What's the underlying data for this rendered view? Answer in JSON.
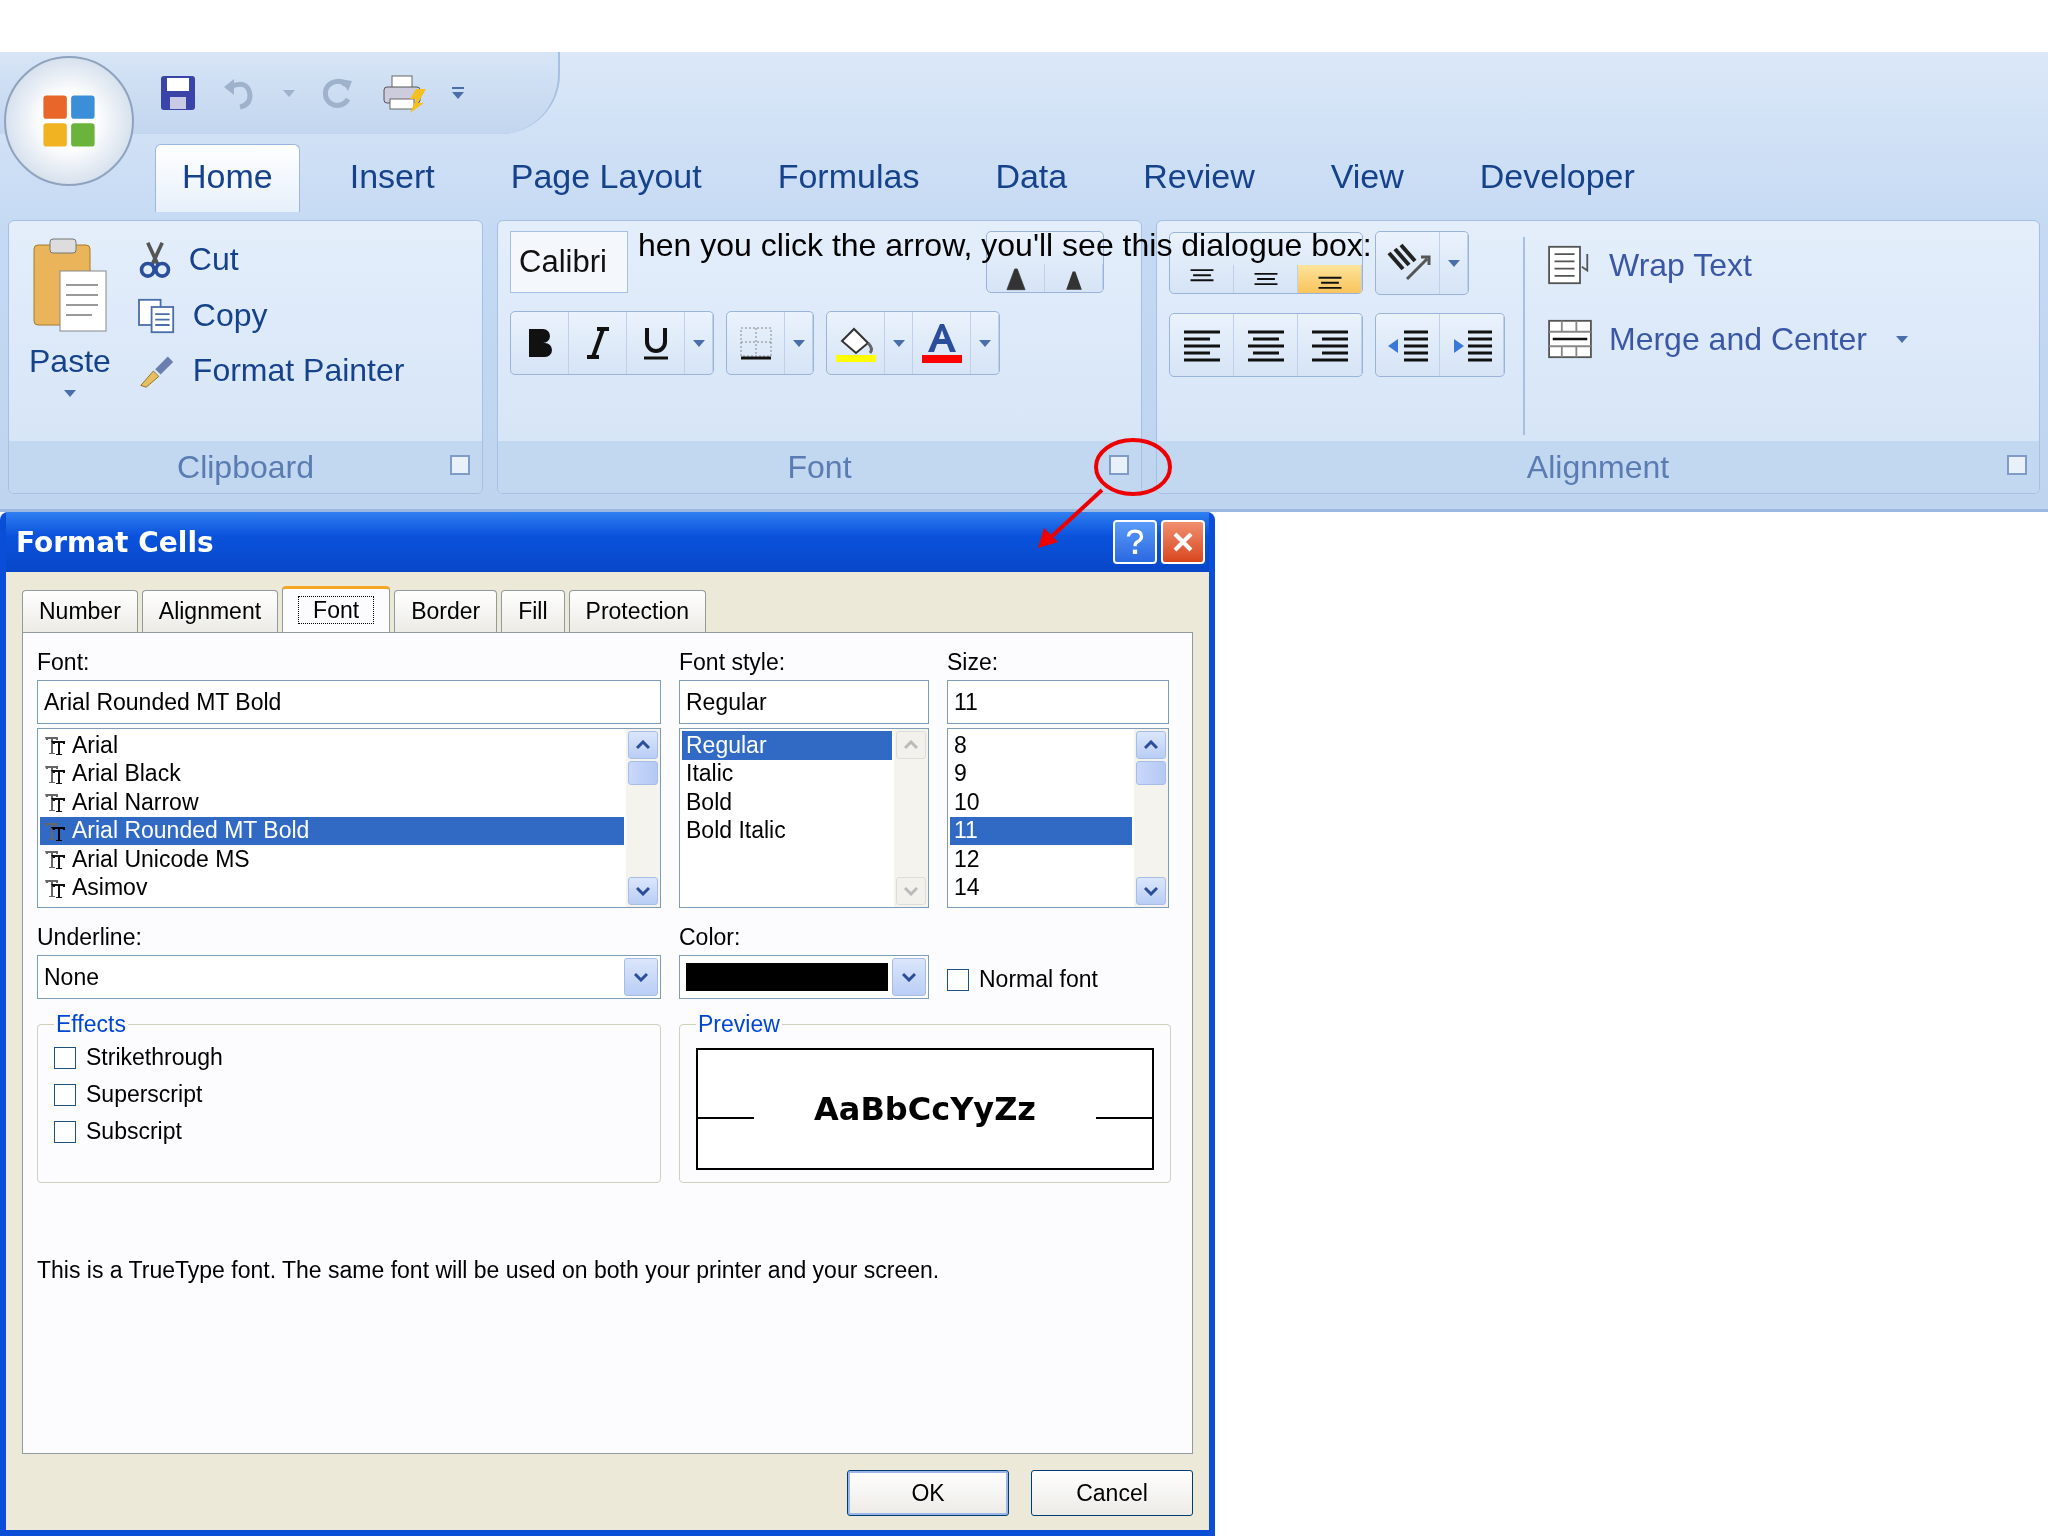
{
  "ribbon_tabs": [
    {
      "label": "Home",
      "selected": true
    },
    {
      "label": "Insert",
      "selected": false
    },
    {
      "label": "Page Layout",
      "selected": false
    },
    {
      "label": "Formulas",
      "selected": false
    },
    {
      "label": "Data",
      "selected": false
    },
    {
      "label": "Review",
      "selected": false
    },
    {
      "label": "View",
      "selected": false
    },
    {
      "label": "Developer",
      "selected": false
    }
  ],
  "clipboard": {
    "paste": "Paste",
    "cut": "Cut",
    "copy": "Copy",
    "format_painter": "Format Painter",
    "title": "Clipboard"
  },
  "font_group": {
    "font_name": "Calibri",
    "title": "Font"
  },
  "alignment_group": {
    "vertical_align": [
      {
        "selected": false
      },
      {
        "selected": false
      },
      {
        "selected": true
      }
    ],
    "wrap_text": "Wrap Text",
    "merge": "Merge and Center",
    "title": "Alignment"
  },
  "caption": "hen you click the arrow, you'll see this dialogue box:",
  "dialog": {
    "title": "Format Cells",
    "tabs": [
      {
        "label": "Number",
        "selected": false
      },
      {
        "label": "Alignment",
        "selected": false
      },
      {
        "label": "Font",
        "selected": true
      },
      {
        "label": "Border",
        "selected": false
      },
      {
        "label": "Fill",
        "selected": false
      },
      {
        "label": "Protection",
        "selected": false
      }
    ],
    "font": {
      "label": "Font:",
      "value": "Arial Rounded MT Bold",
      "items": [
        {
          "name": "Arial",
          "selected": false
        },
        {
          "name": "Arial Black",
          "selected": false
        },
        {
          "name": "Arial Narrow",
          "selected": false
        },
        {
          "name": "Arial Rounded MT Bold",
          "selected": true
        },
        {
          "name": "Arial Unicode MS",
          "selected": false
        },
        {
          "name": "Asimov",
          "selected": false
        }
      ]
    },
    "font_style": {
      "label": "Font style:",
      "value": "Regular",
      "items": [
        {
          "name": "Regular",
          "selected": true
        },
        {
          "name": "Italic",
          "selected": false
        },
        {
          "name": "Bold",
          "selected": false
        },
        {
          "name": "Bold Italic",
          "selected": false
        }
      ]
    },
    "size": {
      "label": "Size:",
      "value": "11",
      "items": [
        {
          "name": "8",
          "selected": false
        },
        {
          "name": "9",
          "selected": false
        },
        {
          "name": "10",
          "selected": false
        },
        {
          "name": "11",
          "selected": true
        },
        {
          "name": "12",
          "selected": false
        },
        {
          "name": "14",
          "selected": false
        }
      ]
    },
    "underline": {
      "label": "Underline:",
      "value": "None"
    },
    "color": {
      "label": "Color:",
      "color": "#000000"
    },
    "normal_font": {
      "label": "Normal font",
      "checked": false
    },
    "effects": {
      "title": "Effects",
      "options": [
        {
          "label": "Strikethrough",
          "checked": false
        },
        {
          "label": "Superscript",
          "checked": false
        },
        {
          "label": "Subscript",
          "checked": false
        }
      ]
    },
    "preview": {
      "title": "Preview",
      "sample": "AaBbCcYyZz"
    },
    "note": "This is a TrueType font.  The same font will be used on both your printer and your screen.",
    "buttons": [
      "OK",
      "Cancel"
    ]
  }
}
